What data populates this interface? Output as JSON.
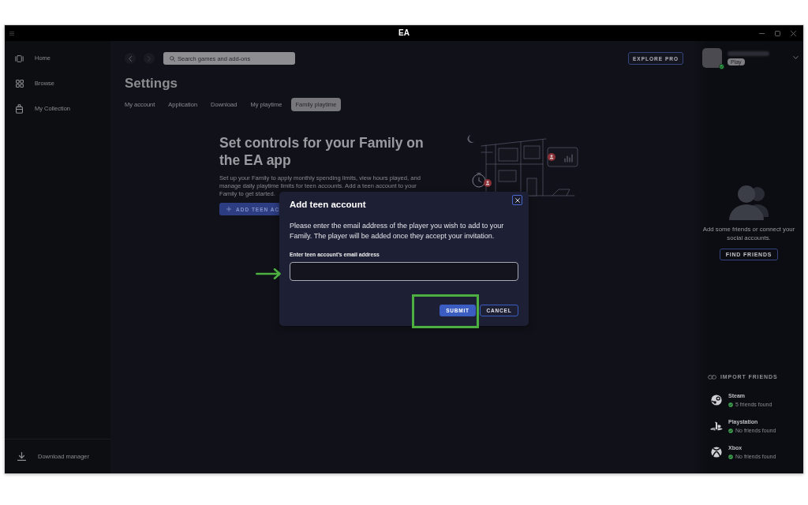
{
  "window": {
    "title": "EA"
  },
  "sidebar": {
    "items": [
      {
        "label": "Home",
        "selected": false
      },
      {
        "label": "Browse",
        "selected": false
      },
      {
        "label": "My Collection",
        "selected": false
      }
    ],
    "footer": {
      "label": "Download manager"
    }
  },
  "toolbar": {
    "search": {
      "placeholder": "Search games and add-ons"
    },
    "explore_button": "EXPLORE PRO"
  },
  "profile": {
    "badge": "Play",
    "online": true
  },
  "settings": {
    "title": "Settings",
    "tabs": [
      {
        "label": "My account",
        "selected": false
      },
      {
        "label": "Application",
        "selected": false
      },
      {
        "label": "Download",
        "selected": false
      },
      {
        "label": "My playtime",
        "selected": false
      },
      {
        "label": "Family playtime",
        "selected": true
      }
    ]
  },
  "family": {
    "heading": "Set controls for your Family on the EA app",
    "text": "Set up your Family to apply monthly spending limits, view hours played, and manage daily playtime limits for teen accounts. Add a teen account to your Family to get started.",
    "add_button": "ADD TEEN AC"
  },
  "dialog": {
    "title": "Add teen account",
    "text": "Please enter the email address of the player you wish to add to your Family. The player will be added once they accept your invitation.",
    "field_label": "Enter teen account’s email address",
    "buttons": [
      {
        "label": "SUBMIT",
        "kind": "primary"
      },
      {
        "label": "CANCEL",
        "kind": "secondary"
      }
    ]
  },
  "friends": {
    "message": "Add some friends or connect your social accounts.",
    "find_button": "FIND FRIENDS",
    "import_title": "IMPORT FRIENDS",
    "accounts": [
      {
        "name": "Steam",
        "status": "5 friends found"
      },
      {
        "name": "Playstation",
        "status": "No friends found"
      },
      {
        "name": "Xbox",
        "status": "No friends found"
      }
    ]
  }
}
